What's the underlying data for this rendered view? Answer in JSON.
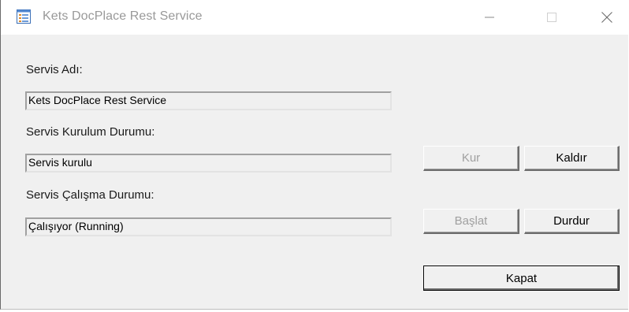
{
  "window": {
    "title": "Kets DocPlace Rest Service",
    "app_icon": "form-list-icon",
    "controls": {
      "minimize_icon": "minimize-icon",
      "maximize_icon": "maximize-icon",
      "close_icon": "close-icon"
    }
  },
  "service": {
    "name_label": "Servis Adı:",
    "name_value": "Kets DocPlace Rest Service",
    "install_label": "Servis Kurulum Durumu:",
    "install_value": "Servis kurulu",
    "run_label": "Servis Çalışma Durumu:",
    "run_value": "Çalışıyor (Running)"
  },
  "buttons": {
    "install": "Kur",
    "uninstall": "Kaldır",
    "start": "Başlat",
    "stop": "Durdur",
    "close": "Kapat"
  },
  "colors": {
    "window_bg": "#f0f0f0",
    "titlebar_bg": "#ffffff",
    "disabled_text": "#a0a0a0",
    "title_text": "#999999"
  }
}
